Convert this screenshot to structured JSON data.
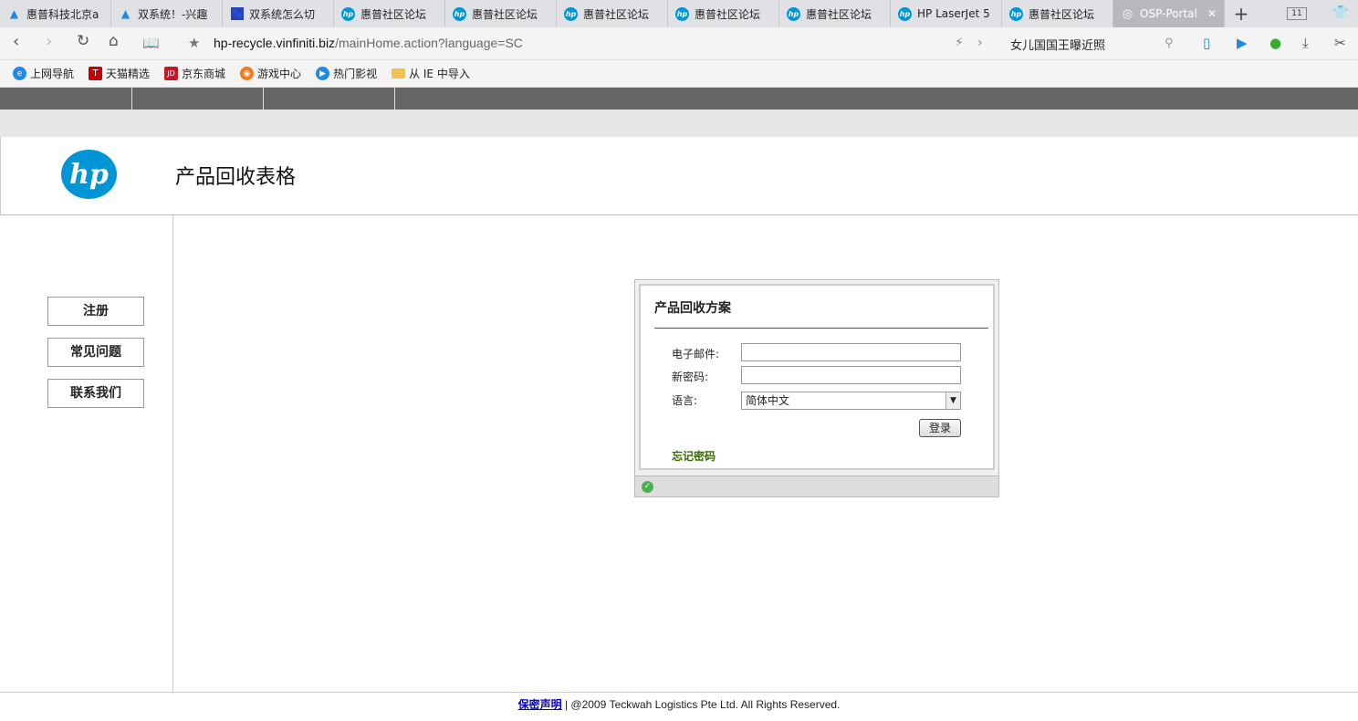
{
  "browser": {
    "tabs": [
      {
        "label": "惠普科技北京a",
        "icon": "triangle-icon"
      },
      {
        "label": "双系统！-兴趣",
        "icon": "triangle-icon"
      },
      {
        "label": "双系统怎么切",
        "icon": "paw-icon"
      },
      {
        "label": "惠普社区论坛",
        "icon": "hp-icon"
      },
      {
        "label": "惠普社区论坛",
        "icon": "hp-icon"
      },
      {
        "label": "惠普社区论坛",
        "icon": "hp-icon"
      },
      {
        "label": "惠普社区论坛",
        "icon": "hp-icon"
      },
      {
        "label": "惠普社区论坛",
        "icon": "hp-icon"
      },
      {
        "label": "HP LaserJet 5",
        "icon": "hp-icon"
      },
      {
        "label": "惠普社区论坛",
        "icon": "hp-icon"
      },
      {
        "label": "OSP-Portal",
        "icon": "globe-icon",
        "active": true
      }
    ],
    "tab_count": "11",
    "url_domain": "hp-recycle.vinfiniti.biz",
    "url_path": "/mainHome.action?language=SC",
    "search_text": "女儿国国王曝近照",
    "bookmarks": [
      {
        "label": "上网导航",
        "icon": "ie-icon"
      },
      {
        "label": "天猫精选",
        "icon": "tmall-icon"
      },
      {
        "label": "京东商城",
        "icon": "jd-icon"
      },
      {
        "label": "游戏中心",
        "icon": "gamepad-icon"
      },
      {
        "label": "热门影视",
        "icon": "play-icon"
      },
      {
        "label": "从 IE 中导入",
        "icon": "folder-icon"
      }
    ]
  },
  "header": {
    "logo_text": "hp",
    "title": "产品回收表格"
  },
  "sidebar": {
    "items": [
      "注册",
      "常见问题",
      "联系我们"
    ]
  },
  "login": {
    "title": "产品回收方案",
    "email_label": "电子邮件:",
    "password_label": "新密码:",
    "language_label": "语言:",
    "language_value": "简体中文",
    "login_button": "登录",
    "forgot_link": "忘记密码"
  },
  "footer": {
    "privacy_link": "保密声明",
    "copyright": " | @2009 Teckwah Logistics Pte Ltd. All Rights Reserved."
  }
}
